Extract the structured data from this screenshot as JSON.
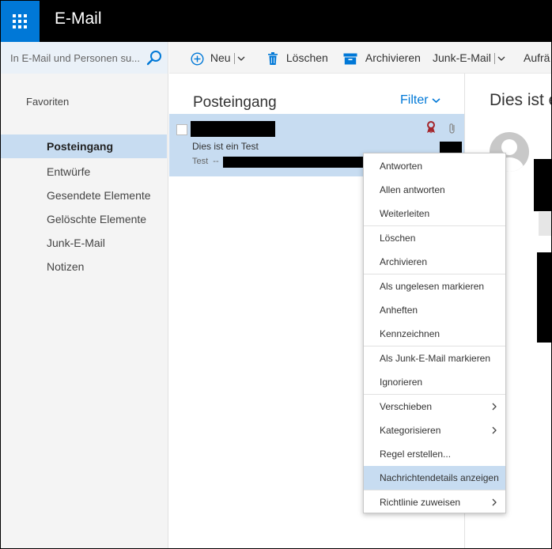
{
  "header": {
    "app_title": "E-Mail"
  },
  "search": {
    "placeholder": "In E-Mail und Personen su..."
  },
  "toolbar": {
    "new_label": "Neu",
    "delete_label": "Löschen",
    "archive_label": "Archivieren",
    "junk_label": "Junk-E-Mail",
    "cleanup_label": "Aufrä"
  },
  "sidebar": {
    "favorites_label": "Favoriten",
    "items": [
      {
        "label": "Posteingang",
        "active": true
      },
      {
        "label": "Entwürfe"
      },
      {
        "label": "Gesendete Elemente"
      },
      {
        "label": "Gelöschte Elemente"
      },
      {
        "label": "Junk-E-Mail"
      },
      {
        "label": "Notizen"
      }
    ]
  },
  "message_list": {
    "title": "Posteingang",
    "filter_label": "Filter",
    "items": [
      {
        "subject": "Dies ist ein Test",
        "preview": "Test  --"
      }
    ]
  },
  "reading_pane": {
    "title": "Dies ist e"
  },
  "context_menu": {
    "items": [
      {
        "label": "Antworten"
      },
      {
        "label": "Allen antworten"
      },
      {
        "label": "Weiterleiten"
      },
      {
        "label": "Löschen"
      },
      {
        "label": "Archivieren"
      },
      {
        "label": "Als ungelesen markieren"
      },
      {
        "label": "Anheften"
      },
      {
        "label": "Kennzeichnen"
      },
      {
        "label": "Als Junk-E-Mail markieren"
      },
      {
        "label": "Ignorieren"
      },
      {
        "label": "Verschieben"
      },
      {
        "label": "Kategorisieren"
      },
      {
        "label": "Regel erstellen..."
      },
      {
        "label": "Nachrichtendetails anzeigen"
      },
      {
        "label": "Richtlinie zuweisen"
      }
    ]
  },
  "colors": {
    "accent": "#0078d7",
    "selection": "#c7dcf1",
    "topbar": "#000000",
    "flag": "#a4262c"
  }
}
